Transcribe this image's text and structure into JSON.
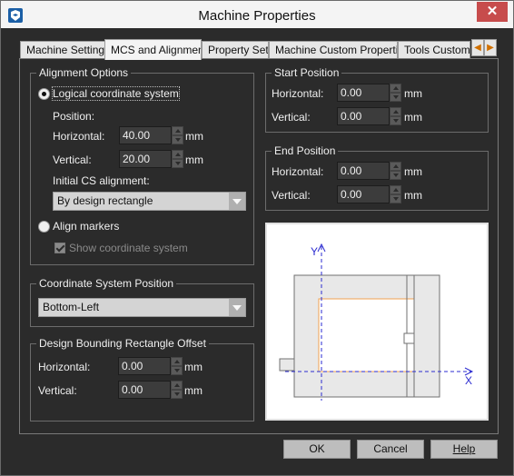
{
  "window": {
    "title": "Machine Properties",
    "close": "✕"
  },
  "tabs": [
    {
      "label": "Machine Settings"
    },
    {
      "label": "MCS and Alignment"
    },
    {
      "label": "Property Sets"
    },
    {
      "label": "Machine Custom Properties"
    },
    {
      "label": "Tools Custom P"
    }
  ],
  "tab_scroll": {
    "left": "◀",
    "right": "▶"
  },
  "alignment": {
    "title": "Alignment Options",
    "logical_label": "Logical coordinate system",
    "position_label": "Position:",
    "horizontal_label": "Horizontal:",
    "horizontal_value": "40.00",
    "vertical_label": "Vertical:",
    "vertical_value": "20.00",
    "unit": "mm",
    "initial_cs_label": "Initial CS alignment:",
    "initial_cs_value": "By design rectangle",
    "align_markers_label": "Align markers",
    "show_cs_label": "Show coordinate system"
  },
  "cs_position": {
    "title": "Coordinate System Position",
    "value": "Bottom-Left"
  },
  "offset": {
    "title": "Design Bounding Rectangle Offset",
    "horizontal_label": "Horizontal:",
    "horizontal_value": "0.00",
    "vertical_label": "Vertical:",
    "vertical_value": "0.00",
    "unit": "mm"
  },
  "start": {
    "title": "Start Position",
    "horizontal_label": "Horizontal:",
    "horizontal_value": "0.00",
    "vertical_label": "Vertical:",
    "vertical_value": "0.00",
    "unit": "mm"
  },
  "end": {
    "title": "End Position",
    "horizontal_label": "Horizontal:",
    "horizontal_value": "0.00",
    "vertical_label": "Vertical:",
    "vertical_value": "0.00",
    "unit": "mm"
  },
  "preview": {
    "y_axis": "Y",
    "x_axis": "X"
  },
  "buttons": {
    "ok": "OK",
    "cancel": "Cancel",
    "help": "Help"
  },
  "colors": {
    "axis": "#2b2bd0",
    "design_rect": "#f0a050",
    "close": "#c74c4c"
  }
}
